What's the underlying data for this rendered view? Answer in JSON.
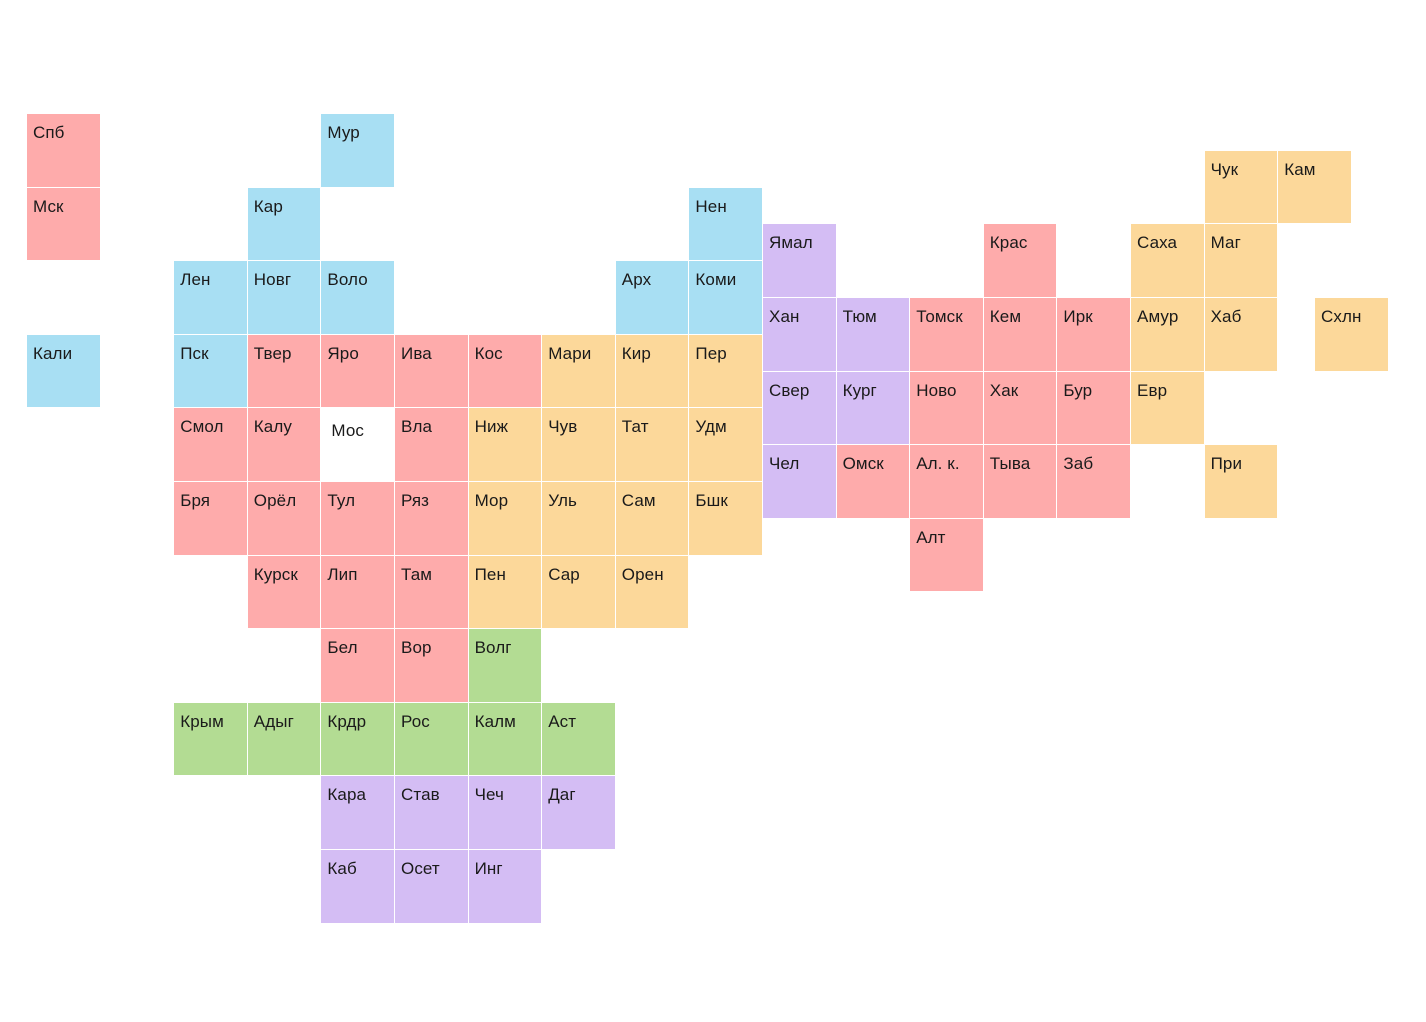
{
  "colors": {
    "red": "#FEABAB",
    "blue": "#A8DFF3",
    "orange": "#FCD89A",
    "green": "#B3DC93",
    "purple": "#D4BDF4"
  },
  "selected_region": "Мос",
  "regions": [
    {
      "label": "Спб",
      "col": 0,
      "row": 0,
      "color": "red"
    },
    {
      "label": "Мск",
      "col": 0,
      "row": 1,
      "color": "red"
    },
    {
      "label": "Кали",
      "col": 0,
      "row": 3,
      "color": "blue"
    },
    {
      "label": "Мур",
      "col": 4,
      "row": 0,
      "color": "blue"
    },
    {
      "label": "Кар",
      "col": 3,
      "row": 1,
      "color": "blue"
    },
    {
      "label": "Нен",
      "col": 9,
      "row": 1,
      "color": "blue"
    },
    {
      "label": "Лен",
      "col": 2,
      "row": 2,
      "color": "blue"
    },
    {
      "label": "Новг",
      "col": 3,
      "row": 2,
      "color": "blue"
    },
    {
      "label": "Воло",
      "col": 4,
      "row": 2,
      "color": "blue"
    },
    {
      "label": "Арх",
      "col": 8,
      "row": 2,
      "color": "blue"
    },
    {
      "label": "Коми",
      "col": 9,
      "row": 2,
      "color": "blue"
    },
    {
      "label": "Пск",
      "col": 2,
      "row": 3,
      "color": "blue"
    },
    {
      "label": "Твер",
      "col": 3,
      "row": 3,
      "color": "red"
    },
    {
      "label": "Яро",
      "col": 4,
      "row": 3,
      "color": "red"
    },
    {
      "label": "Ива",
      "col": 5,
      "row": 3,
      "color": "red"
    },
    {
      "label": "Кос",
      "col": 6,
      "row": 3,
      "color": "red"
    },
    {
      "label": "Мари",
      "col": 7,
      "row": 3,
      "color": "orange"
    },
    {
      "label": "Кир",
      "col": 8,
      "row": 3,
      "color": "orange"
    },
    {
      "label": "Пер",
      "col": 9,
      "row": 3,
      "color": "orange"
    },
    {
      "label": "Смол",
      "col": 2,
      "row": 4,
      "color": "red"
    },
    {
      "label": "Калу",
      "col": 3,
      "row": 4,
      "color": "red"
    },
    {
      "label": "Мос",
      "col": 4,
      "row": 4,
      "color": "red",
      "selected": true
    },
    {
      "label": "Вла",
      "col": 5,
      "row": 4,
      "color": "red"
    },
    {
      "label": "Ниж",
      "col": 6,
      "row": 4,
      "color": "orange"
    },
    {
      "label": "Чув",
      "col": 7,
      "row": 4,
      "color": "orange"
    },
    {
      "label": "Тат",
      "col": 8,
      "row": 4,
      "color": "orange"
    },
    {
      "label": "Удм",
      "col": 9,
      "row": 4,
      "color": "orange"
    },
    {
      "label": "Бря",
      "col": 2,
      "row": 5,
      "color": "red"
    },
    {
      "label": "Орёл",
      "col": 3,
      "row": 5,
      "color": "red"
    },
    {
      "label": "Тул",
      "col": 4,
      "row": 5,
      "color": "red"
    },
    {
      "label": "Ряз",
      "col": 5,
      "row": 5,
      "color": "red"
    },
    {
      "label": "Мор",
      "col": 6,
      "row": 5,
      "color": "orange"
    },
    {
      "label": "Уль",
      "col": 7,
      "row": 5,
      "color": "orange"
    },
    {
      "label": "Сам",
      "col": 8,
      "row": 5,
      "color": "orange"
    },
    {
      "label": "Бшк",
      "col": 9,
      "row": 5,
      "color": "orange"
    },
    {
      "label": "Курск",
      "col": 3,
      "row": 6,
      "color": "red"
    },
    {
      "label": "Лип",
      "col": 4,
      "row": 6,
      "color": "red"
    },
    {
      "label": "Там",
      "col": 5,
      "row": 6,
      "color": "red"
    },
    {
      "label": "Пен",
      "col": 6,
      "row": 6,
      "color": "orange"
    },
    {
      "label": "Сар",
      "col": 7,
      "row": 6,
      "color": "orange"
    },
    {
      "label": "Орен",
      "col": 8,
      "row": 6,
      "color": "orange"
    },
    {
      "label": "Бел",
      "col": 4,
      "row": 7,
      "color": "red"
    },
    {
      "label": "Вор",
      "col": 5,
      "row": 7,
      "color": "red"
    },
    {
      "label": "Волг",
      "col": 6,
      "row": 7,
      "color": "green"
    },
    {
      "label": "Крым",
      "col": 2,
      "row": 8,
      "color": "green"
    },
    {
      "label": "Адыг",
      "col": 3,
      "row": 8,
      "color": "green"
    },
    {
      "label": "Крдр",
      "col": 4,
      "row": 8,
      "color": "green"
    },
    {
      "label": "Рос",
      "col": 5,
      "row": 8,
      "color": "green"
    },
    {
      "label": "Калм",
      "col": 6,
      "row": 8,
      "color": "green"
    },
    {
      "label": "Аст",
      "col": 7,
      "row": 8,
      "color": "green"
    },
    {
      "label": "Кара",
      "col": 4,
      "row": 9,
      "color": "purple"
    },
    {
      "label": "Став",
      "col": 5,
      "row": 9,
      "color": "purple"
    },
    {
      "label": "Чеч",
      "col": 6,
      "row": 9,
      "color": "purple"
    },
    {
      "label": "Даг",
      "col": 7,
      "row": 9,
      "color": "purple"
    },
    {
      "label": "Каб",
      "col": 4,
      "row": 10,
      "color": "purple"
    },
    {
      "label": "Осет",
      "col": 5,
      "row": 10,
      "color": "purple"
    },
    {
      "label": "Инг",
      "col": 6,
      "row": 10,
      "color": "purple"
    },
    {
      "label": "Ямал",
      "col": 10,
      "row": 1.5,
      "color": "purple"
    },
    {
      "label": "Крас",
      "col": 13,
      "row": 1.5,
      "color": "red"
    },
    {
      "label": "Саха",
      "col": 15,
      "row": 1.5,
      "color": "orange"
    },
    {
      "label": "Маг",
      "col": 16,
      "row": 1.5,
      "color": "orange"
    },
    {
      "label": "Чук",
      "col": 16,
      "row": 0.5,
      "color": "orange"
    },
    {
      "label": "Кам",
      "col": 17,
      "row": 0.5,
      "color": "orange"
    },
    {
      "label": "Хан",
      "col": 10,
      "row": 2.5,
      "color": "purple"
    },
    {
      "label": "Тюм",
      "col": 11,
      "row": 2.5,
      "color": "purple"
    },
    {
      "label": "Томск",
      "col": 12,
      "row": 2.5,
      "color": "red"
    },
    {
      "label": "Кем",
      "col": 13,
      "row": 2.5,
      "color": "red"
    },
    {
      "label": "Ирк",
      "col": 14,
      "row": 2.5,
      "color": "red"
    },
    {
      "label": "Амур",
      "col": 15,
      "row": 2.5,
      "color": "orange"
    },
    {
      "label": "Хаб",
      "col": 16,
      "row": 2.5,
      "color": "orange"
    },
    {
      "label": "Схлн",
      "col": 17.5,
      "row": 2.5,
      "color": "orange"
    },
    {
      "label": "Свер",
      "col": 10,
      "row": 3.5,
      "color": "purple"
    },
    {
      "label": "Кург",
      "col": 11,
      "row": 3.5,
      "color": "purple"
    },
    {
      "label": "Ново",
      "col": 12,
      "row": 3.5,
      "color": "red"
    },
    {
      "label": "Хак",
      "col": 13,
      "row": 3.5,
      "color": "red"
    },
    {
      "label": "Бур",
      "col": 14,
      "row": 3.5,
      "color": "red"
    },
    {
      "label": "Евр",
      "col": 15,
      "row": 3.5,
      "color": "orange"
    },
    {
      "label": "Чел",
      "col": 10,
      "row": 4.5,
      "color": "purple"
    },
    {
      "label": "Омск",
      "col": 11,
      "row": 4.5,
      "color": "red"
    },
    {
      "label": "Ал. к.",
      "col": 12,
      "row": 4.5,
      "color": "red"
    },
    {
      "label": "Тыва",
      "col": 13,
      "row": 4.5,
      "color": "red"
    },
    {
      "label": "Заб",
      "col": 14,
      "row": 4.5,
      "color": "red"
    },
    {
      "label": "При",
      "col": 16,
      "row": 4.5,
      "color": "orange"
    },
    {
      "label": "Алт",
      "col": 12,
      "row": 5.5,
      "color": "red"
    }
  ]
}
